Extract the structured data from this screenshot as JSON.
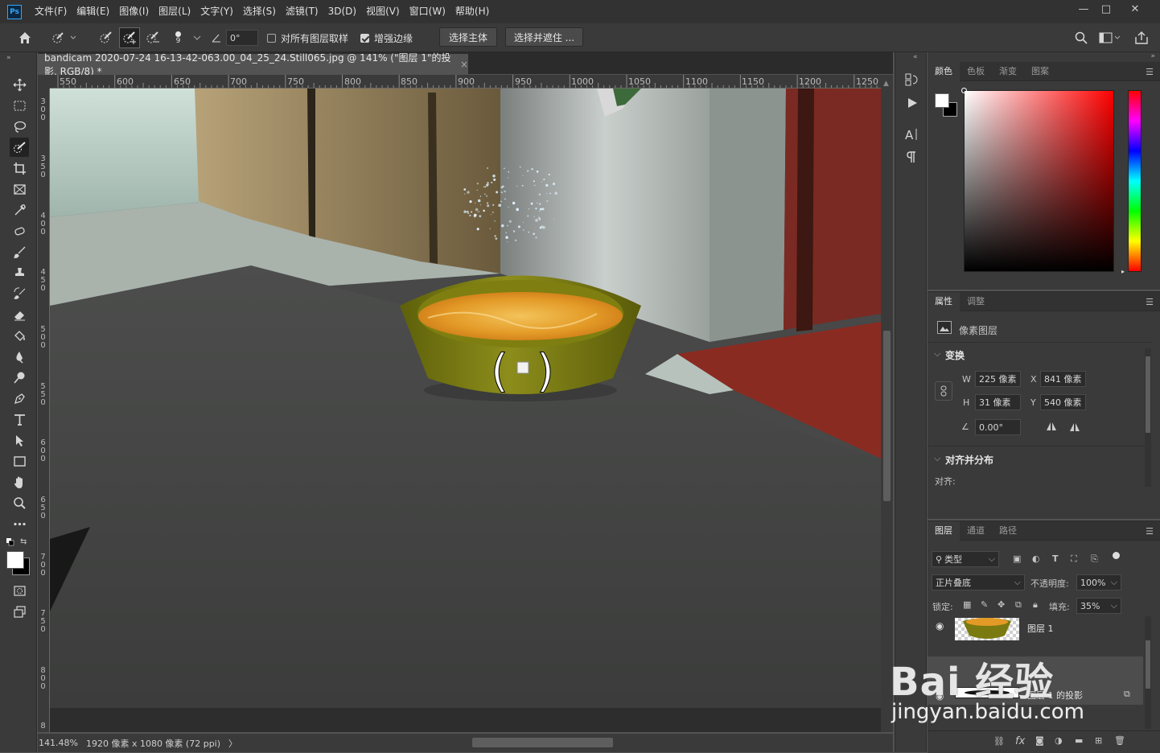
{
  "app": {
    "logo": "Ps"
  },
  "menu": [
    "文件(F)",
    "编辑(E)",
    "图像(I)",
    "图层(L)",
    "文字(Y)",
    "选择(S)",
    "滤镜(T)",
    "3D(D)",
    "视图(V)",
    "窗口(W)",
    "帮助(H)"
  ],
  "window_controls": {
    "minimize": "—",
    "maximize": "□",
    "close": "✕"
  },
  "options": {
    "brush_size": "9",
    "angle": "0°",
    "sample_all_layers": "对所有图层取样",
    "enhance_edge": "增强边缘",
    "select_subject": "选择主体",
    "select_and_mask": "选择并遮住 ..."
  },
  "document": {
    "tab_title": "bandicam 2020-07-24 16-13-42-063.00_04_25_24.Still065.jpg @ 141% (\"图层 1\"的投影, RGB/8) *",
    "close": "×"
  },
  "ruler": {
    "h": [
      "550",
      "600",
      "650",
      "700",
      "750",
      "800",
      "850",
      "900",
      "950",
      "1000",
      "1050",
      "1100",
      "1150",
      "1200",
      "1250"
    ],
    "v": [
      "3\n0\n0",
      "3\n5\n0",
      "4\n0\n0",
      "4\n5\n0",
      "5\n0\n0",
      "5\n5\n0",
      "6\n0\n0",
      "6\n5\n0",
      "7\n0\n0",
      "7\n5\n0",
      "8\n0\n0",
      "8"
    ]
  },
  "status": {
    "zoom": "141.48%",
    "info": "1920 像素 x 1080 像素 (72 ppi)",
    "arrow": "〉"
  },
  "color_panel": {
    "tabs": [
      "颜色",
      "色板",
      "渐变",
      "图案"
    ]
  },
  "properties_panel": {
    "tabs": [
      "属性",
      "调整"
    ],
    "layer_type": "像素图层",
    "transform_title": "变换",
    "w_label": "W",
    "w": "225 像素",
    "x_label": "X",
    "x": "841 像素",
    "h_label": "H",
    "h": "31 像素",
    "y_label": "Y",
    "y": "540 像素",
    "angle": "0.00°",
    "align_title": "对齐并分布",
    "align_label": "对齐:"
  },
  "layers_panel": {
    "tabs": [
      "图层",
      "通道",
      "路径"
    ],
    "filter": "类型",
    "blend_mode": "正片叠底",
    "opacity_label": "不透明度:",
    "opacity": "100%",
    "lock_label": "锁定:",
    "fill_label": "填充:",
    "fill": "35%",
    "layers": [
      {
        "name": "图层 1"
      },
      {
        "name": "图层 1 的投影"
      }
    ],
    "footer_fx": "fx"
  },
  "watermark": {
    "line1": "Bai 经验",
    "line2": "jingyan.baidu.com"
  },
  "colors": {
    "accent": "#31a8ff",
    "bowl": "#7a7a10",
    "food": "#e39a26",
    "floor_red": "#8a2b22"
  }
}
